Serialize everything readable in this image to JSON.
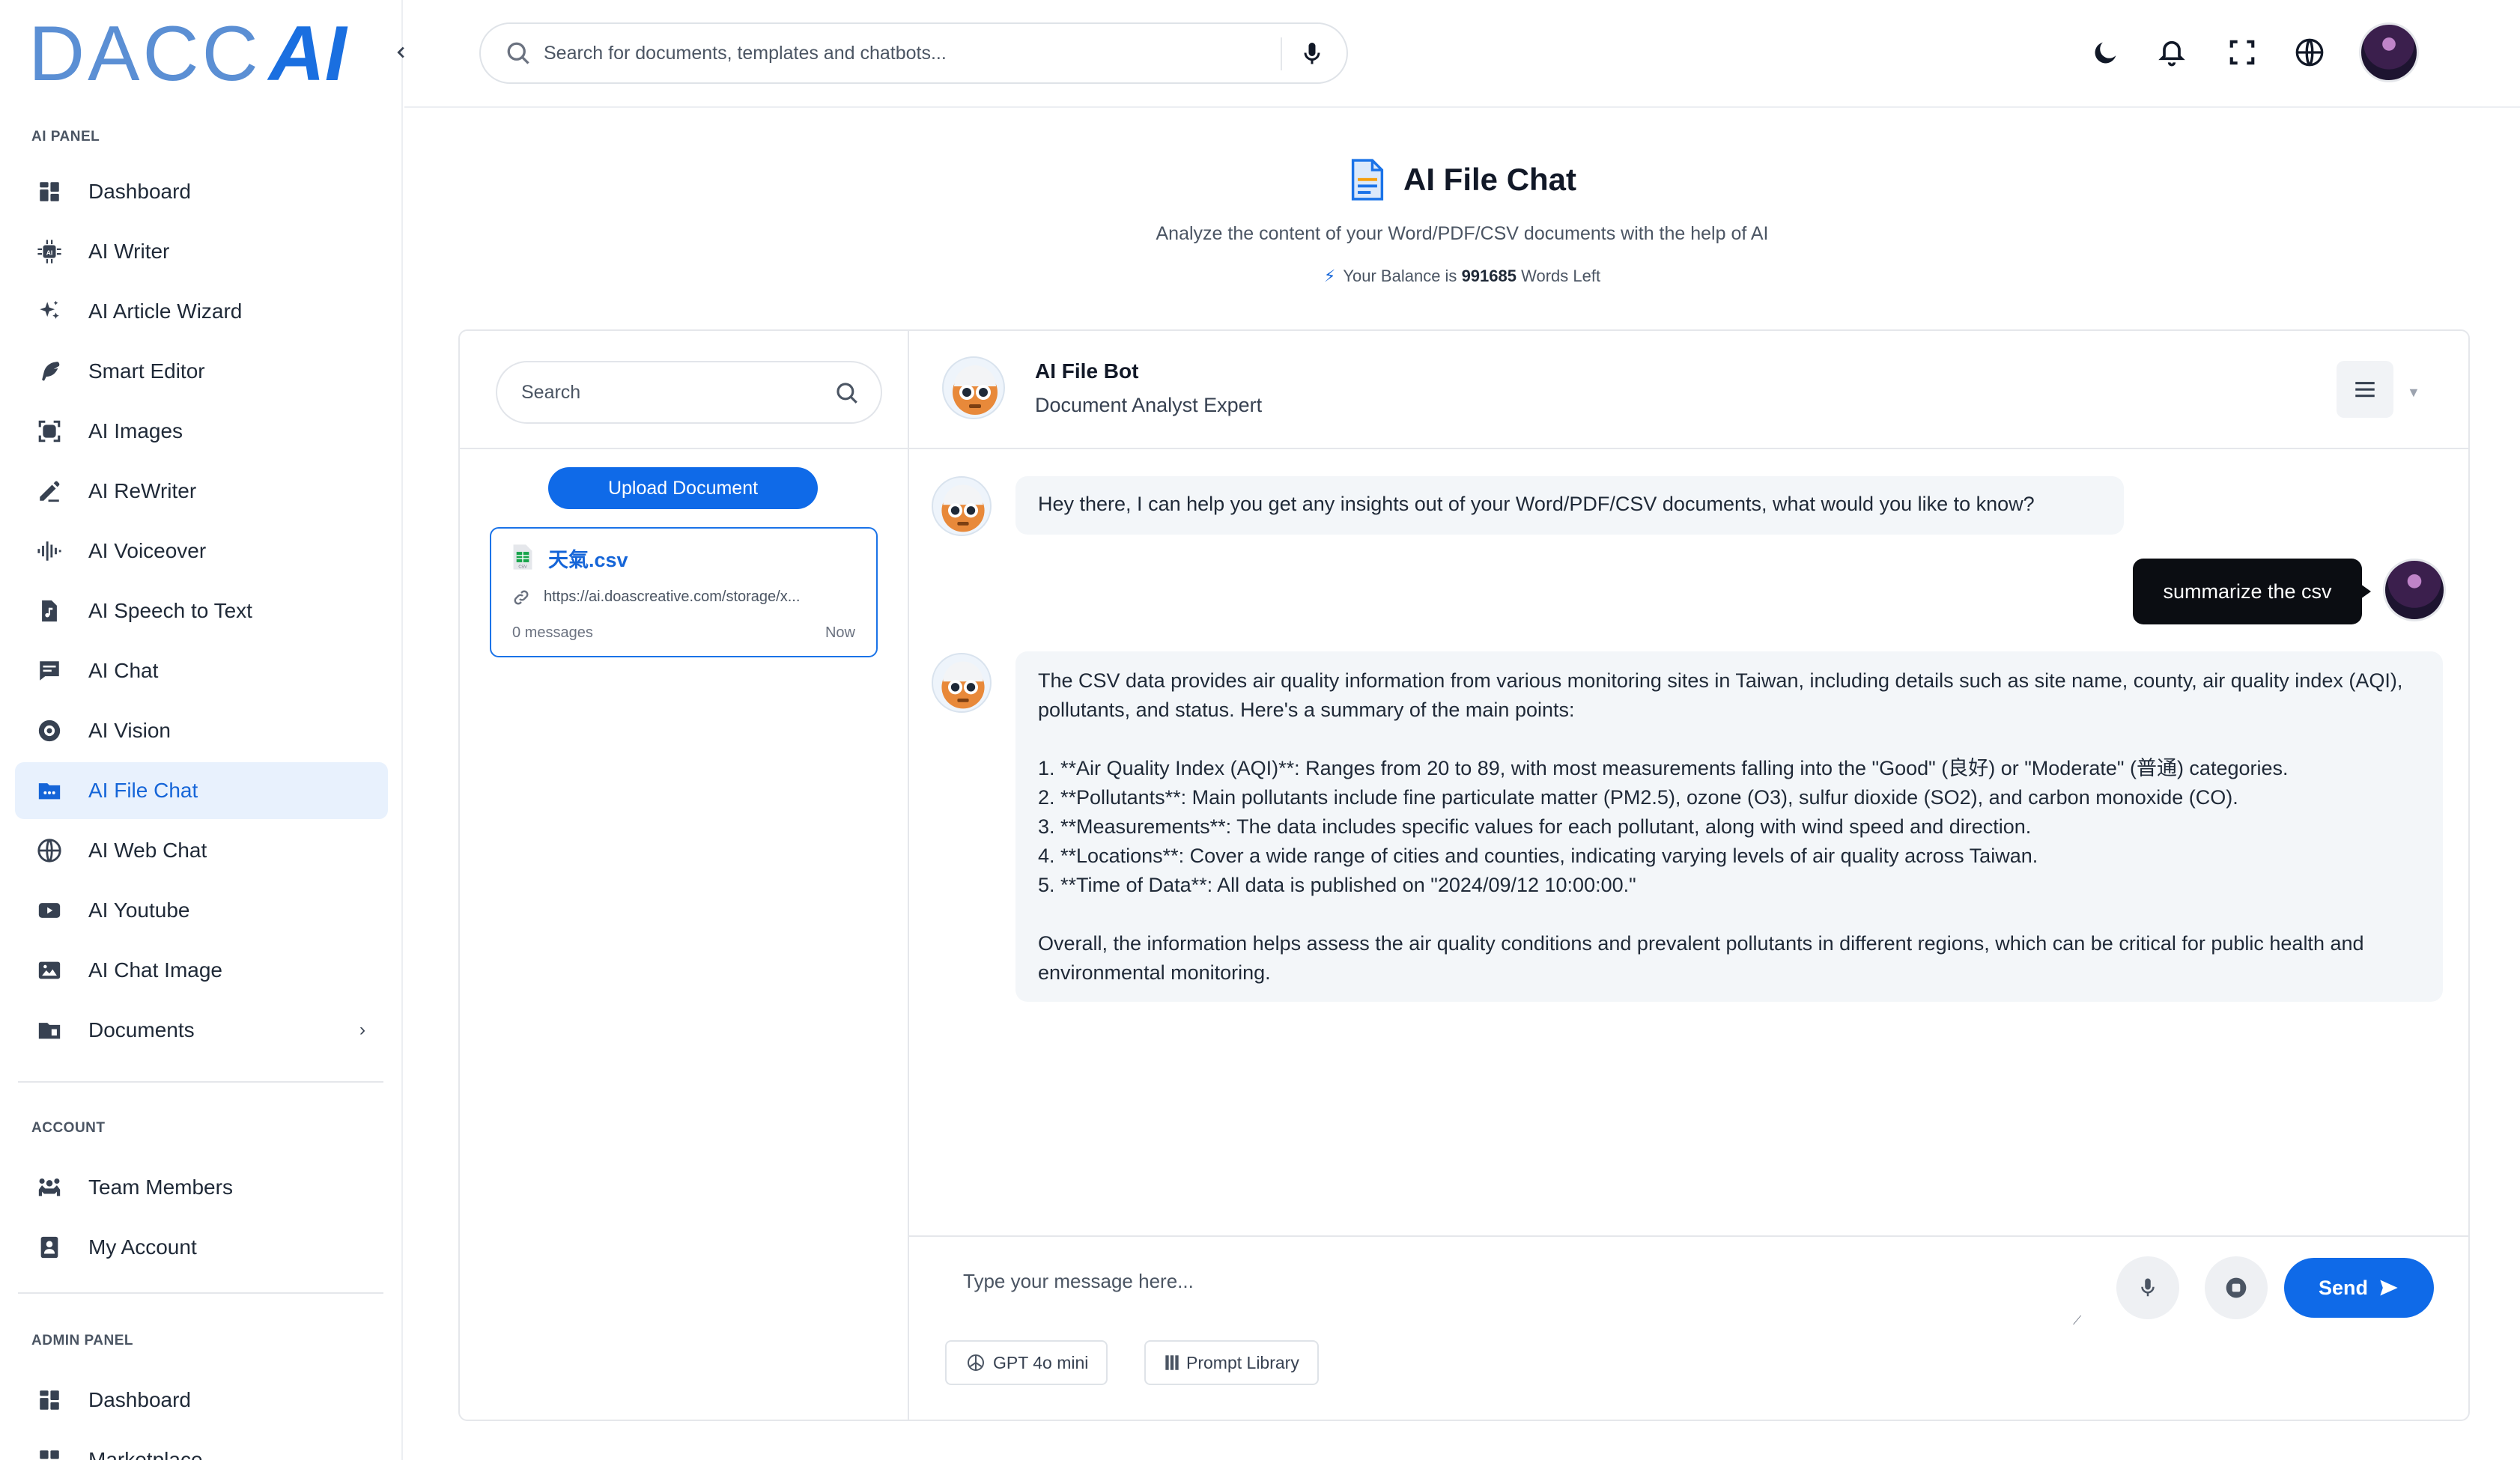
{
  "brand": {
    "name_part1": "DACC",
    "name_part2": "AI",
    "accent": "#1a6fe0"
  },
  "sidebar": {
    "sections": [
      {
        "label": "AI PANEL"
      },
      {
        "label": "ACCOUNT"
      },
      {
        "label": "ADMIN PANEL"
      }
    ],
    "ai_panel_items": [
      {
        "label": "Dashboard",
        "icon": "dashboard-icon"
      },
      {
        "label": "AI Writer",
        "icon": "ai-chip-icon"
      },
      {
        "label": "AI Article Wizard",
        "icon": "sparkles-icon"
      },
      {
        "label": "Smart Editor",
        "icon": "feather-icon"
      },
      {
        "label": "AI Images",
        "icon": "image-scan-icon"
      },
      {
        "label": "AI ReWriter",
        "icon": "pen-icon"
      },
      {
        "label": "AI Voiceover",
        "icon": "waveform-icon"
      },
      {
        "label": "AI Speech to Text",
        "icon": "music-file-icon"
      },
      {
        "label": "AI Chat",
        "icon": "chat-icon"
      },
      {
        "label": "AI Vision",
        "icon": "vision-icon"
      },
      {
        "label": "AI File Chat",
        "icon": "folder-chat-icon",
        "active": true
      },
      {
        "label": "AI Web Chat",
        "icon": "globe-icon"
      },
      {
        "label": "AI Youtube",
        "icon": "youtube-icon"
      },
      {
        "label": "AI Chat Image",
        "icon": "picture-icon"
      },
      {
        "label": "Documents",
        "icon": "documents-icon",
        "has_submenu": true
      }
    ],
    "account_items": [
      {
        "label": "Team Members",
        "icon": "team-icon"
      },
      {
        "label": "My Account",
        "icon": "account-icon"
      }
    ],
    "admin_items": [
      {
        "label": "Dashboard",
        "icon": "dashboard-icon"
      },
      {
        "label": "Marketplace",
        "icon": "marketplace-icon"
      }
    ]
  },
  "header": {
    "search_placeholder": "Search for documents, templates and chatbots..."
  },
  "page": {
    "title": "AI File Chat",
    "subtitle": "Analyze the content of your Word/PDF/CSV documents with the help of AI",
    "balance_prefix": "Your Balance is",
    "balance_value": "991685",
    "balance_suffix": "Words Left"
  },
  "documents": {
    "search_placeholder": "Search",
    "upload_label": "Upload Document",
    "files": [
      {
        "name": "天氣.csv",
        "url": "https://ai.doascreative.com/storage/x...",
        "messages": "0 messages",
        "time": "Now"
      }
    ]
  },
  "chat": {
    "bot_name": "AI File Bot",
    "bot_role": "Document Analyst Expert",
    "messages": {
      "greeting": "Hey there, I can help you get any insights out of your Word/PDF/CSV documents, what would you like to know?",
      "user": "summarize the csv",
      "reply_intro": "The CSV data provides air quality information from various monitoring sites in Taiwan, including details such as site name, county, air quality index (AQI), pollutants, and status. Here's a summary of the main points:",
      "reply_points": [
        "1. **Air Quality Index (AQI)**: Ranges from 20 to 89, with most measurements falling into the \"Good\" (良好) or \"Moderate\" (普通) categories.",
        "2. **Pollutants**: Main pollutants include fine particulate matter (PM2.5), ozone (O3), sulfur dioxide (SO2), and carbon monoxide (CO).",
        "3. **Measurements**: The data includes specific values for each pollutant, along with wind speed and direction.",
        "4. **Locations**: Cover a wide range of cities and counties, indicating varying levels of air quality across Taiwan.",
        "5. **Time of Data**: All data is published on \"2024/09/12 10:00:00.\""
      ],
      "reply_outro": "Overall, the information helps assess the air quality conditions and prevalent pollutants in different regions, which can be critical for public health and environmental monitoring."
    },
    "input_placeholder": "Type your message here...",
    "send_label": "Send",
    "model_label": "GPT 4o mini",
    "prompt_library_label": "Prompt Library"
  }
}
